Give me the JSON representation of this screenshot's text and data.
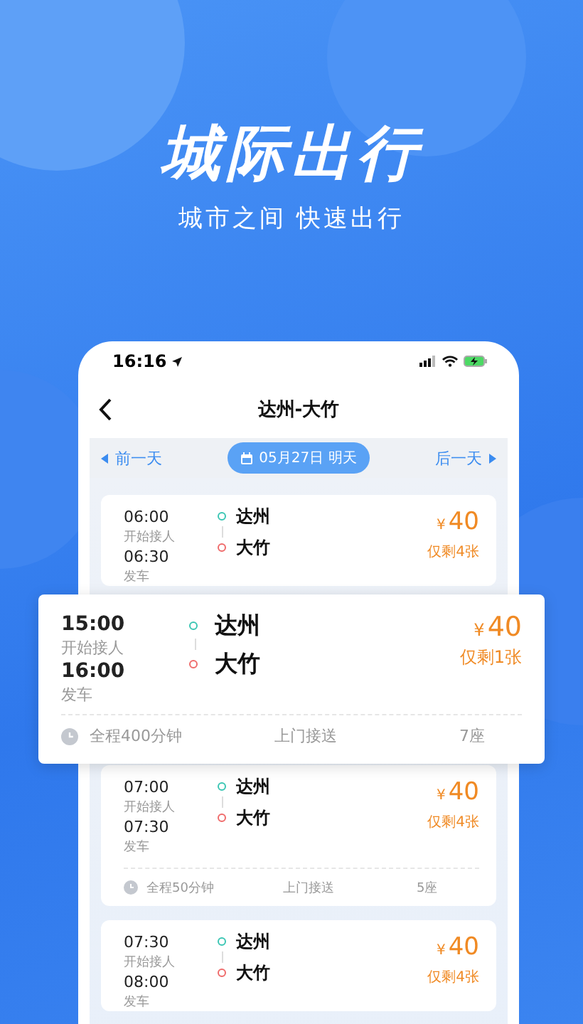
{
  "header": {
    "title": "城际出行",
    "subtitle": "城市之间 快速出行"
  },
  "status_bar": {
    "time": "16:16"
  },
  "nav": {
    "title": "达州-大竹"
  },
  "date_bar": {
    "prev": "前一天",
    "date": "05月27日 明天",
    "next": "后一天"
  },
  "trips": [
    {
      "pickup_time": "06:00",
      "pickup_label": "开始接人",
      "depart_time": "06:30",
      "depart_label": "发车",
      "from": "达州",
      "to": "大竹",
      "currency": "¥",
      "price": "40",
      "remaining": "仅剩4张"
    },
    {
      "pickup_time": "07:00",
      "pickup_label": "开始接人",
      "depart_time": "07:30",
      "depart_label": "发车",
      "from": "达州",
      "to": "大竹",
      "currency": "¥",
      "price": "40",
      "remaining": "仅剩4张",
      "duration": "全程50分钟",
      "service": "上门接送",
      "seats": "5座"
    },
    {
      "pickup_time": "07:30",
      "pickup_label": "开始接人",
      "depart_time": "08:00",
      "depart_label": "发车",
      "from": "达州",
      "to": "大竹",
      "currency": "¥",
      "price": "40",
      "remaining": "仅剩4张"
    }
  ],
  "featured_trip": {
    "pickup_time": "15:00",
    "pickup_label": "开始接人",
    "depart_time": "16:00",
    "depart_label": "发车",
    "from": "达州",
    "to": "大竹",
    "currency": "¥",
    "price": "40",
    "remaining": "仅剩1张",
    "duration": "全程400分钟",
    "service": "上门接送",
    "seats": "7座"
  }
}
